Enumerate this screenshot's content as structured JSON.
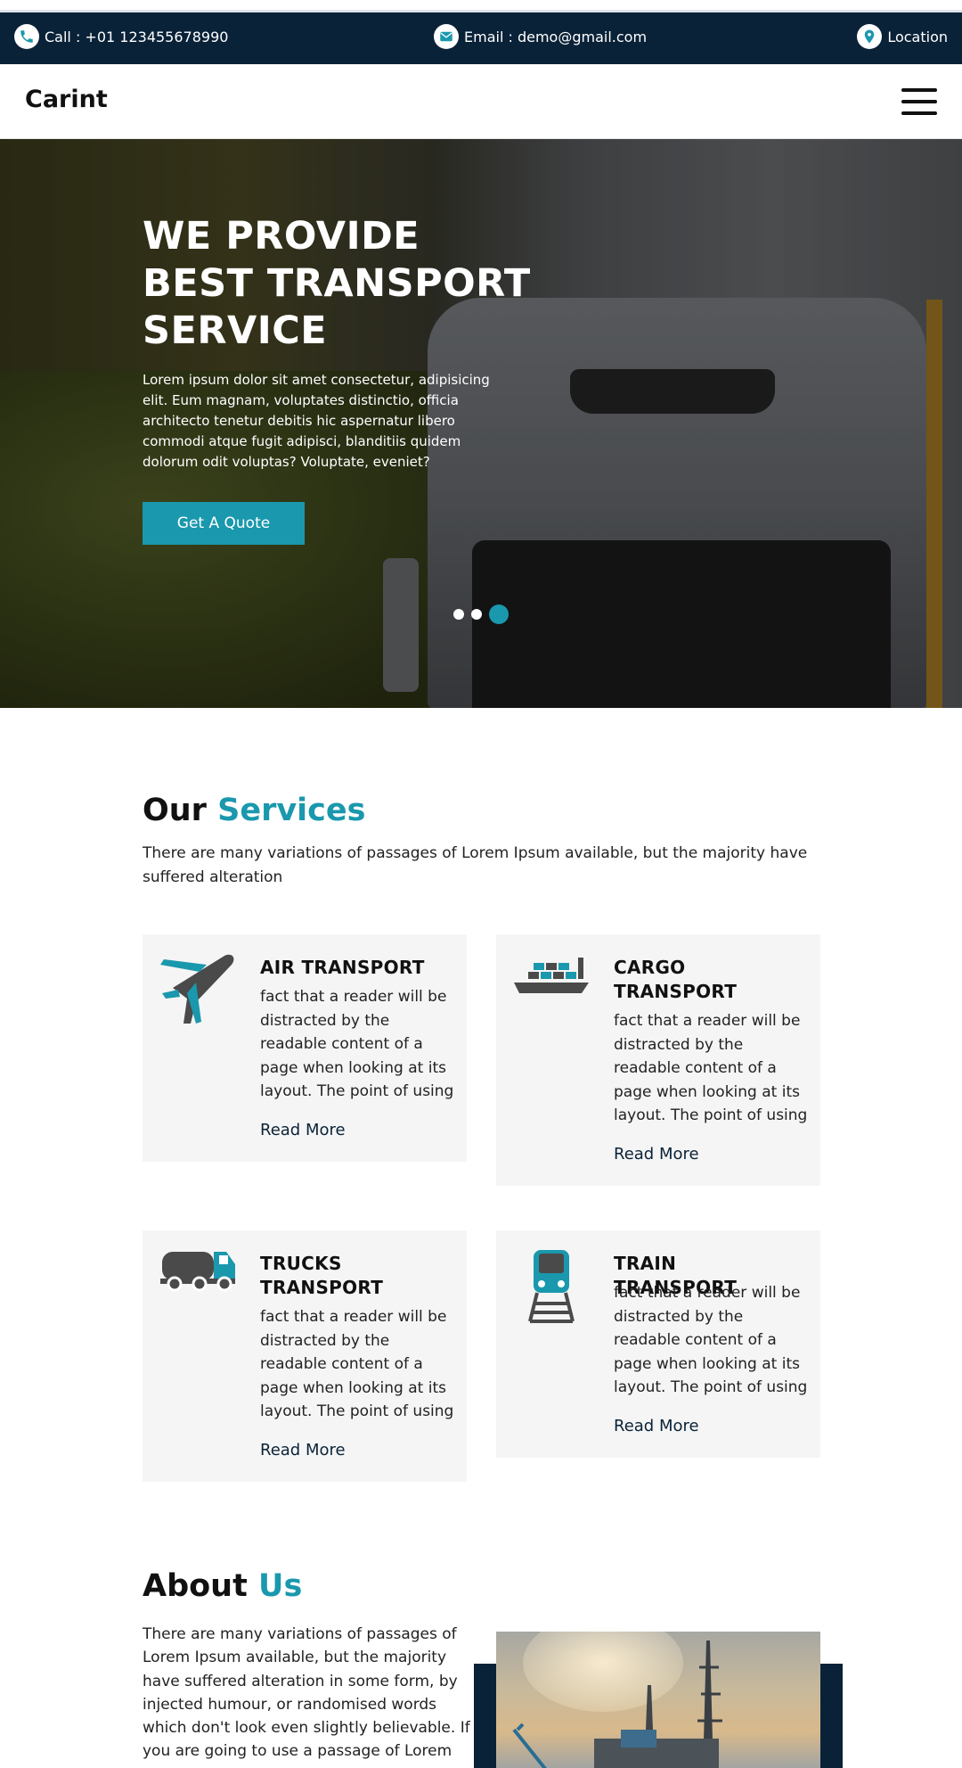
{
  "topbar": {
    "call": "Call : +01 123455678990",
    "email": "Email : demo@gmail.com",
    "location": "Location"
  },
  "nav": {
    "brand": "Carint"
  },
  "hero": {
    "title": "WE PROVIDE BEST TRANSPORT SERVICE",
    "text": "Lorem ipsum dolor sit amet consectetur, adipisicing elit. Eum magnam, voluptates distinctio, officia architecto tenetur debitis hic aspernatur libero commodi atque fugit adipisci, blanditiis quidem dolorum odit voluptas? Voluptate, eveniet?",
    "button": "Get A Quote",
    "slides": 3,
    "active_slide": 3
  },
  "services": {
    "title_plain": "Our",
    "title_accent": "Services",
    "subtitle": "There are many variations of passages of Lorem Ipsum available, but the majority have suffered alteration",
    "items": [
      {
        "title": "AIR TRANSPORT",
        "text": "fact that a reader will be distracted by the readable content of a page when looking at its layout. The point of using",
        "link": "Read More",
        "icon": "airplane-icon"
      },
      {
        "title": "CARGO TRANSPORT",
        "text": "fact that a reader will be distracted by the readable content of a page when looking at its layout. The point of using",
        "link": "Read More",
        "icon": "cargo-ship-icon"
      },
      {
        "title": "TRUCKS TRANSPORT",
        "text": "fact that a reader will be distracted by the readable content of a page when looking at its layout. The point of using",
        "link": "Read More",
        "icon": "truck-icon"
      },
      {
        "title": "TRAIN TRANSPORT",
        "text": "fact that a reader will be distracted by the readable content of a page when looking at its layout. The point of using",
        "link": "Read More",
        "icon": "train-icon"
      }
    ]
  },
  "about": {
    "title_plain": "About",
    "title_accent": "Us",
    "text": "There are many variations of passages of Lorem Ipsum available, but the majority have suffered alteration in some form, by injected humour, or randomised words which don't look even slightly believable. If you are going to use a passage of Lorem"
  },
  "colors": {
    "navy": "#0a2238",
    "accent": "#1a98ad",
    "icon_gray": "#4a4a4a"
  }
}
